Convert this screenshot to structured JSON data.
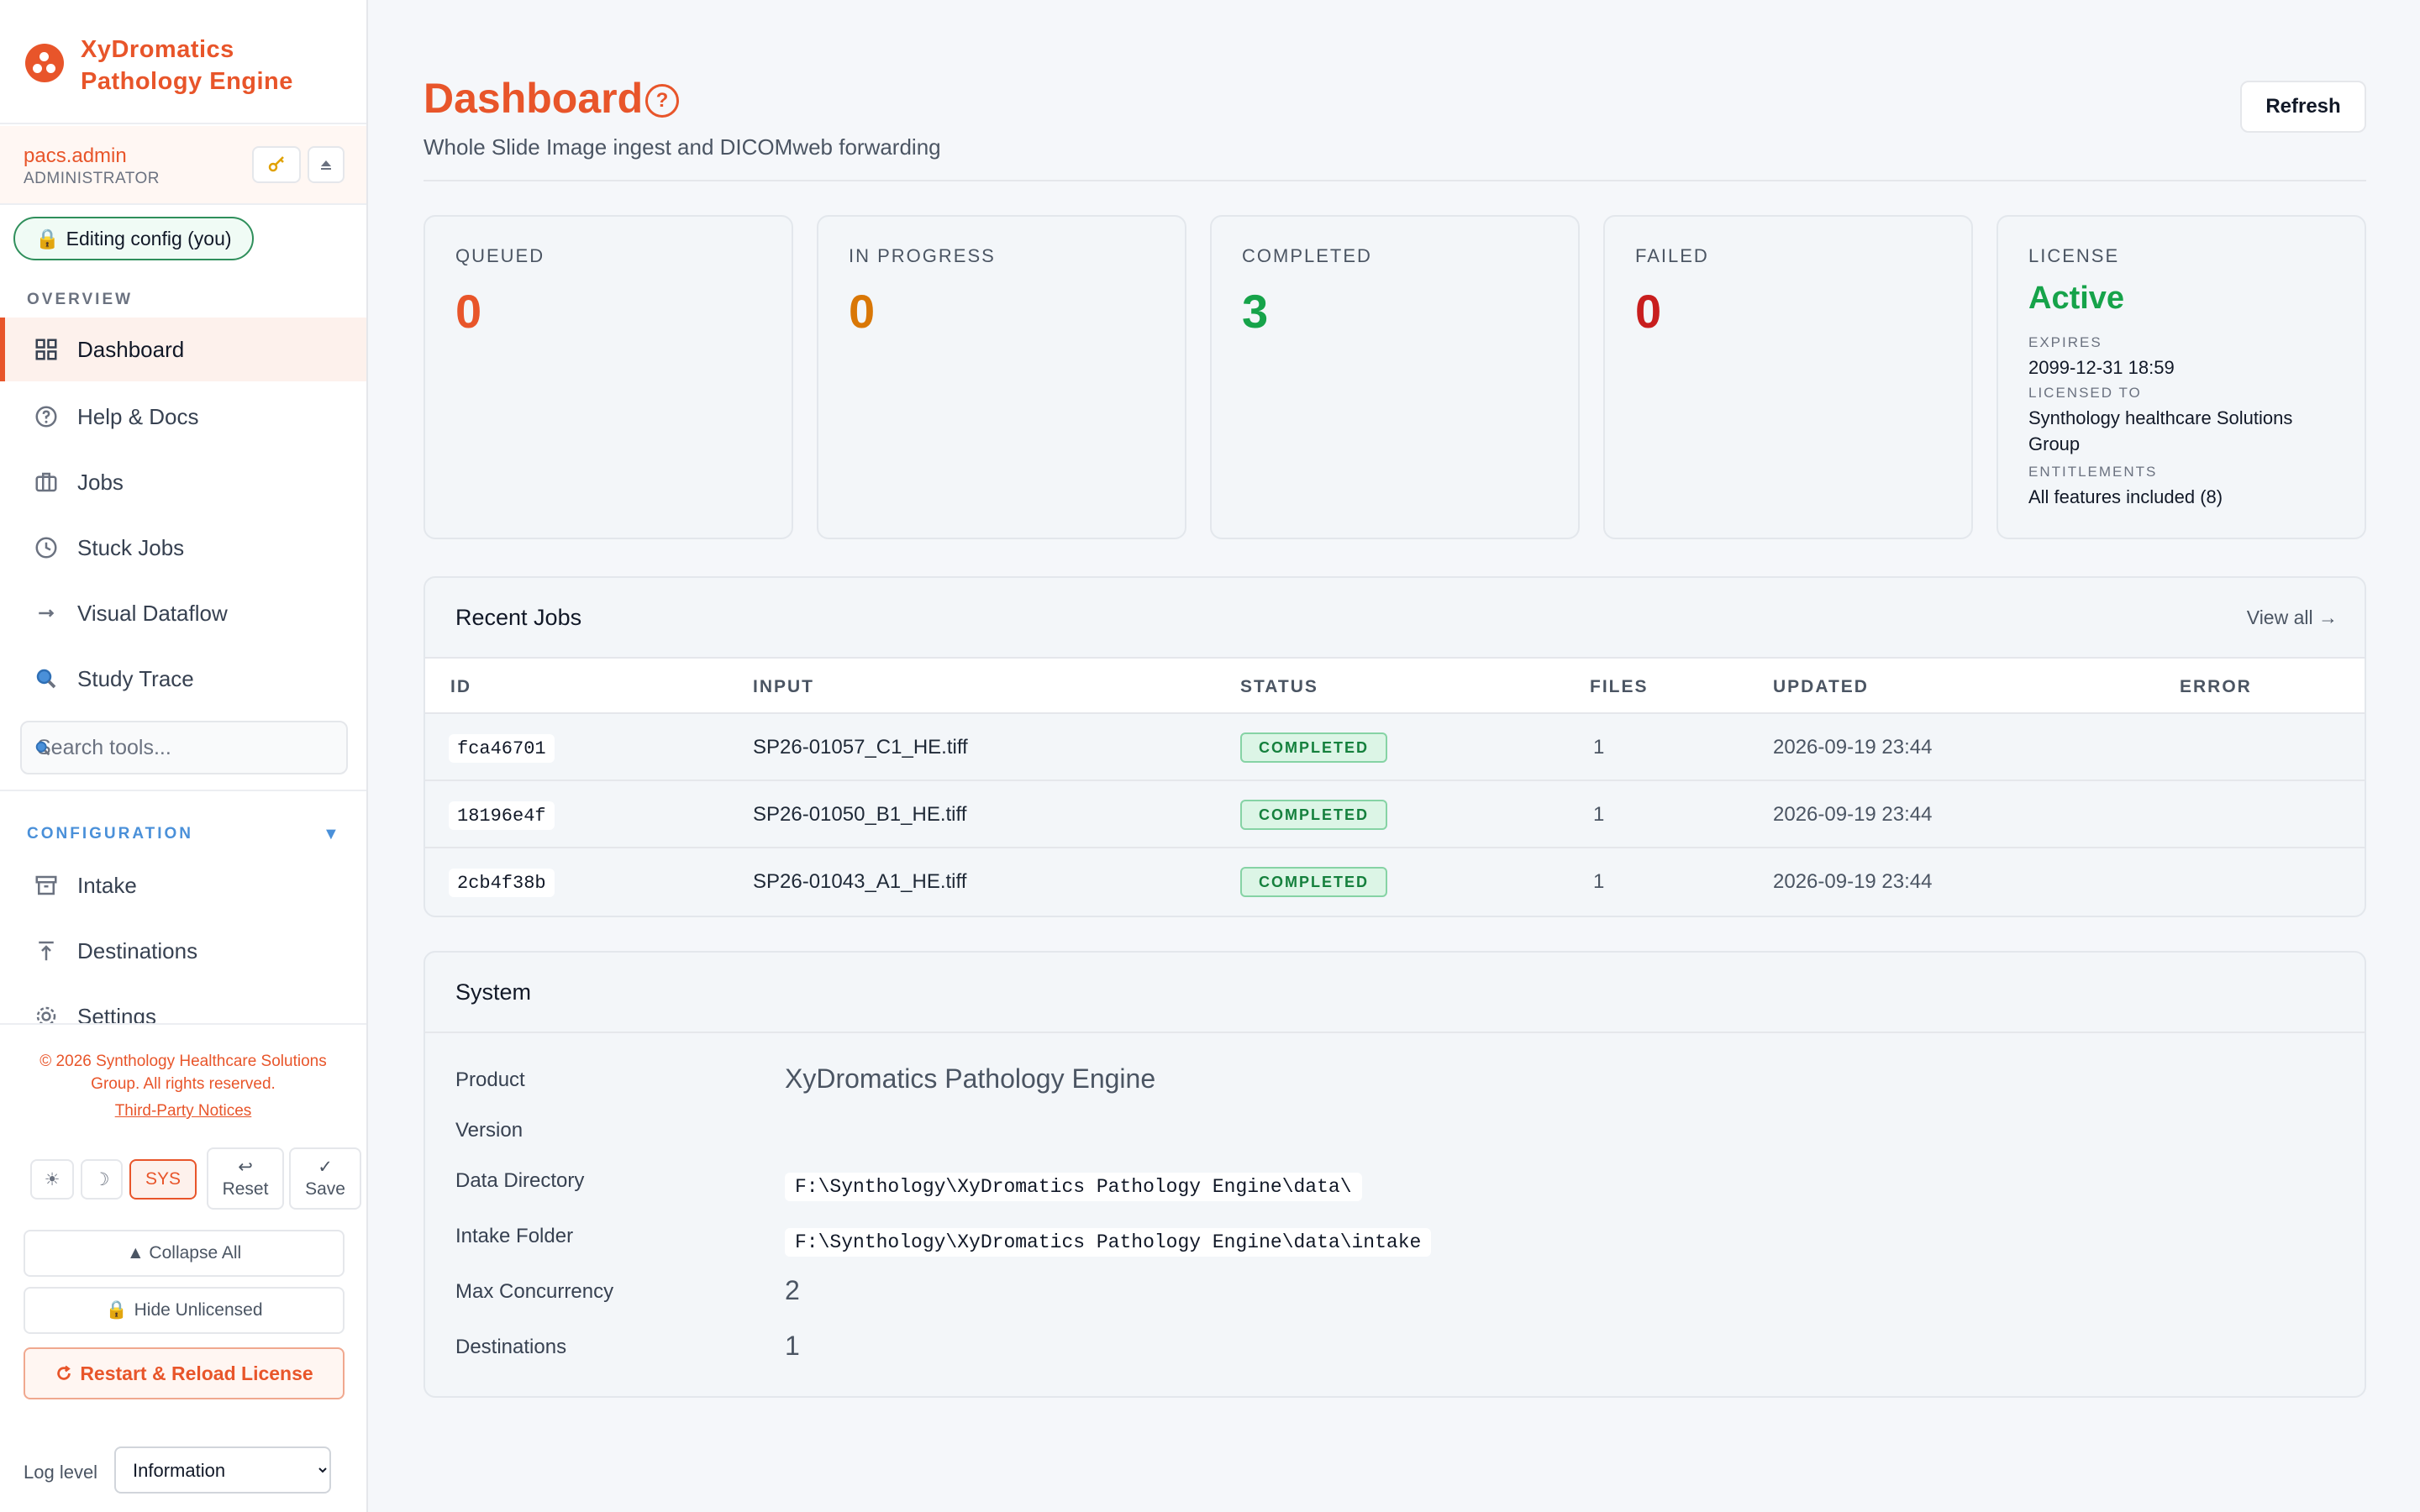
{
  "brand": {
    "name": "XyDromatics Pathology Engine"
  },
  "user": {
    "name": "pacs.admin",
    "role": "ADMINISTRATOR",
    "key_icon": "key-icon",
    "eject_icon": "eject-icon"
  },
  "edit_badge": "Editing config (you)",
  "sections": {
    "overview": "OVERVIEW",
    "configuration": "CONFIGURATION"
  },
  "nav_overview": [
    {
      "label": "Dashboard",
      "icon": "grid-icon",
      "active": true
    },
    {
      "label": "Help & Docs",
      "icon": "help-circle-icon"
    },
    {
      "label": "Jobs",
      "icon": "briefcase-icon"
    },
    {
      "label": "Stuck Jobs",
      "icon": "clock-icon"
    },
    {
      "label": "Visual Dataflow",
      "icon": "arrow-right-icon"
    },
    {
      "label": "Study Trace",
      "icon": "search-icon"
    }
  ],
  "search_tools": {
    "placeholder": "Search tools..."
  },
  "nav_config": [
    {
      "label": "Intake",
      "icon": "archive-icon"
    },
    {
      "label": "Destinations",
      "icon": "upload-icon"
    },
    {
      "label": "Settings",
      "icon": "gear-icon"
    }
  ],
  "footer": {
    "copyright": "© 2026 Synthology Healthcare Solutions Group. All rights reserved.",
    "notices": "Third-Party Notices",
    "theme_light": "☀",
    "theme_dark": "☽",
    "theme_sys": "SYS",
    "reset_icon": "↩",
    "reset": "Reset",
    "save_icon": "✓",
    "save": "Save",
    "collapse_all": "▲ Collapse All",
    "hide_unlicensed": "Hide Unlicensed",
    "restart": "Restart & Reload License",
    "log_level_label": "Log level",
    "log_level_value": "Information"
  },
  "header": {
    "title": "Dashboard",
    "help": "?",
    "subtitle": "Whole Slide Image ingest and DICOMweb forwarding",
    "refresh": "Refresh"
  },
  "stats": [
    {
      "label": "QUEUED",
      "value": "0",
      "color": "#e8552a"
    },
    {
      "label": "IN PROGRESS",
      "value": "0",
      "color": "#d97706"
    },
    {
      "label": "COMPLETED",
      "value": "3",
      "color": "#16a34a"
    },
    {
      "label": "FAILED",
      "value": "0",
      "color": "#c81e1e"
    }
  ],
  "license": {
    "label": "LICENSE",
    "status": "Active",
    "expires_label": "EXPIRES",
    "expires": "2099-12-31 18:59",
    "licensed_to_label": "LICENSED TO",
    "licensed_to": "Synthology healthcare Solutions Group",
    "entitlements_label": "ENTITLEMENTS",
    "entitlements": "All features included (8)"
  },
  "recent_jobs": {
    "title": "Recent Jobs",
    "view_all": "View all →",
    "columns": [
      "ID",
      "INPUT",
      "STATUS",
      "FILES",
      "UPDATED",
      "ERROR"
    ],
    "rows": [
      {
        "id": "fca46701",
        "input": "SP26-01057_C1_HE.tiff",
        "status": "COMPLETED",
        "files": "1",
        "updated": "2026-09-19 23:44",
        "error": ""
      },
      {
        "id": "18196e4f",
        "input": "SP26-01050_B1_HE.tiff",
        "status": "COMPLETED",
        "files": "1",
        "updated": "2026-09-19 23:44",
        "error": ""
      },
      {
        "id": "2cb4f38b",
        "input": "SP26-01043_A1_HE.tiff",
        "status": "COMPLETED",
        "files": "1",
        "updated": "2026-09-19 23:44",
        "error": ""
      }
    ]
  },
  "system": {
    "title": "System",
    "product_label": "Product",
    "product": "XyDromatics Pathology Engine",
    "version_label": "Version",
    "version": "",
    "data_dir_label": "Data Directory",
    "data_dir": "F:\\Synthology\\XyDromatics Pathology Engine\\data\\",
    "intake_label": "Intake Folder",
    "intake": "F:\\Synthology\\XyDromatics Pathology Engine\\data\\intake",
    "concurrency_label": "Max Concurrency",
    "concurrency": "2",
    "destinations_label": "Destinations",
    "destinations": "1"
  }
}
